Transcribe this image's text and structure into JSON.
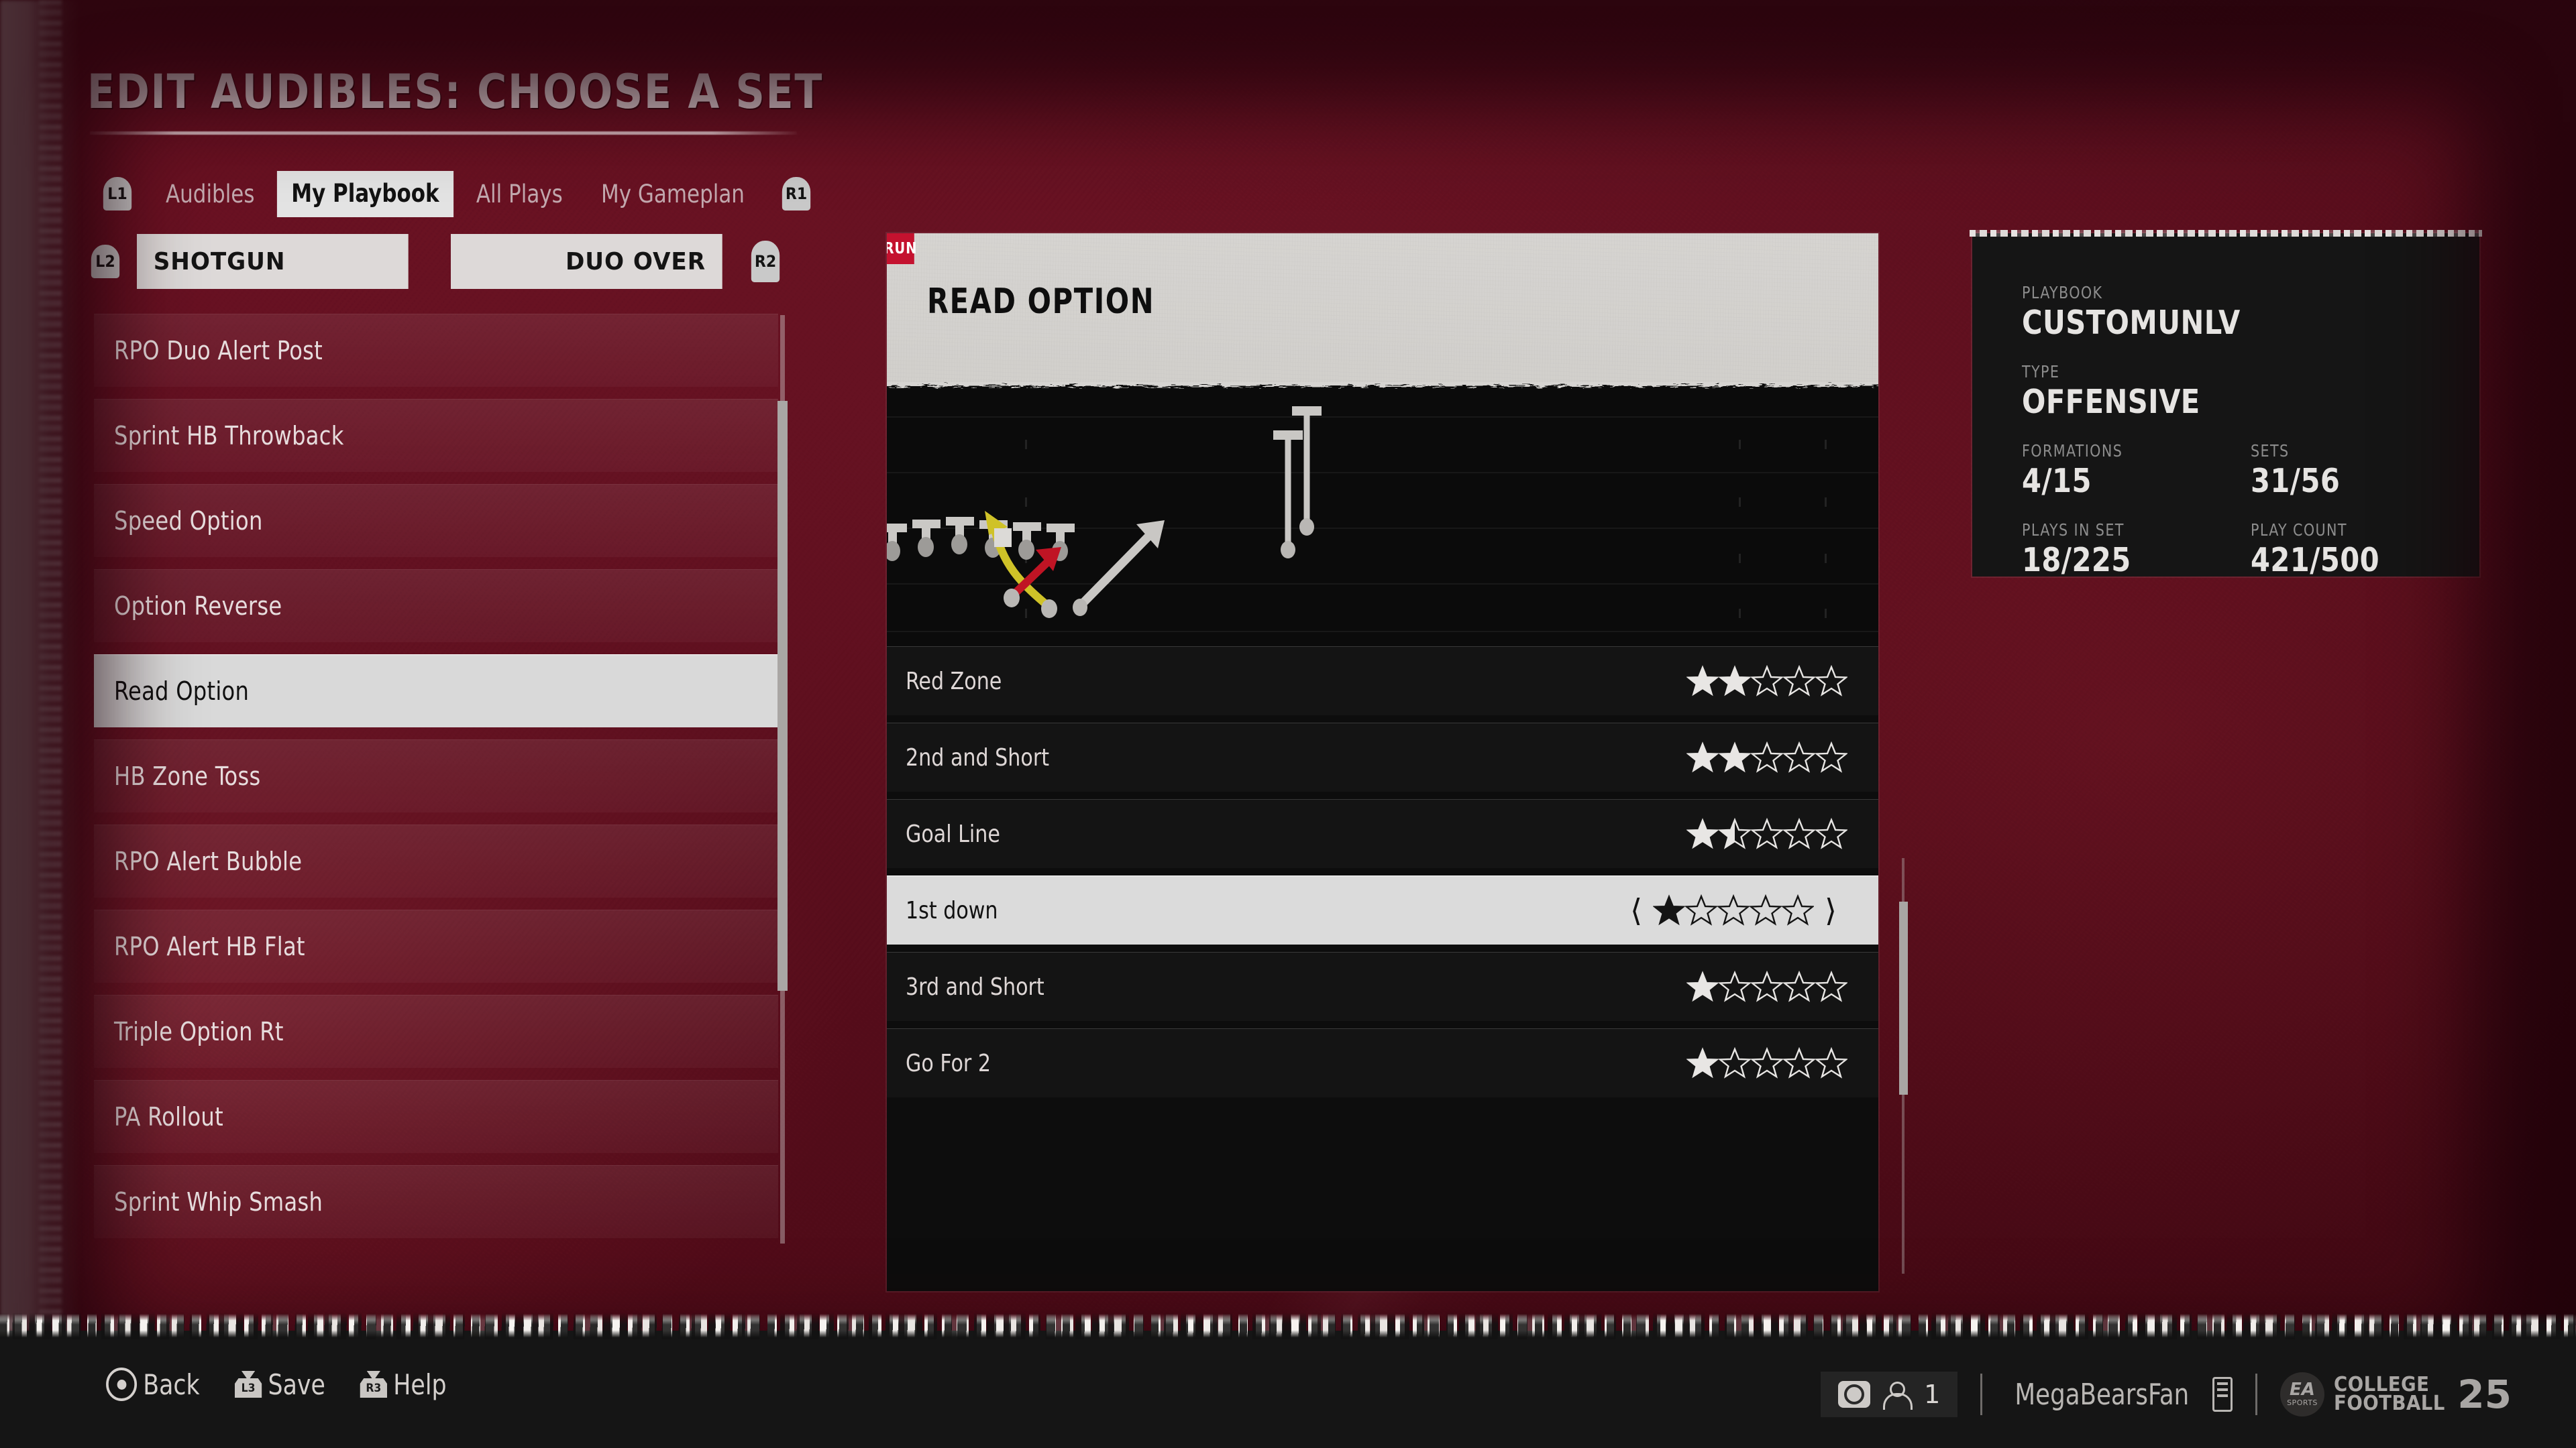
{
  "header": {
    "title": "EDIT AUDIBLES: CHOOSE A SET"
  },
  "tabs": {
    "left_bumper": "L1",
    "right_bumper": "R1",
    "items": [
      {
        "label": "Audibles",
        "selected": false
      },
      {
        "label": "My Playbook",
        "selected": true
      },
      {
        "label": "All Plays",
        "selected": false
      },
      {
        "label": "My Gameplan",
        "selected": false
      }
    ]
  },
  "set_selector": {
    "left_bumper": "L2",
    "right_bumper": "R2",
    "formation": "SHOTGUN",
    "set": "DUO OVER"
  },
  "playlist": {
    "items": [
      {
        "label": "RPO Duo Alert Post",
        "selected": false
      },
      {
        "label": "Sprint HB Throwback",
        "selected": false
      },
      {
        "label": "Speed Option",
        "selected": false
      },
      {
        "label": "Option Reverse",
        "selected": false
      },
      {
        "label": "Read Option",
        "selected": true
      },
      {
        "label": "HB Zone Toss",
        "selected": false
      },
      {
        "label": "RPO Alert Bubble",
        "selected": false
      },
      {
        "label": "RPO Alert HB Flat",
        "selected": false
      },
      {
        "label": "Triple Option Rt",
        "selected": false
      },
      {
        "label": "PA Rollout",
        "selected": false
      },
      {
        "label": "Sprint Whip Smash",
        "selected": false
      }
    ]
  },
  "play_card": {
    "type_tag": "RUN",
    "play_name": "READ OPTION",
    "type_tag_color": "#c4122f"
  },
  "situations": {
    "max_stars": 5,
    "prev_arrow": "‹",
    "next_arrow": "›",
    "rows": [
      {
        "label": "Red Zone",
        "stars": 2,
        "selected": false
      },
      {
        "label": "2nd and Short",
        "stars": 2,
        "selected": false
      },
      {
        "label": "Goal Line",
        "stars": 1.5,
        "selected": false
      },
      {
        "label": "1st down",
        "stars": 1,
        "selected": true
      },
      {
        "label": "3rd and Short",
        "stars": 1,
        "selected": false
      },
      {
        "label": "Go For 2",
        "stars": 1,
        "selected": false
      }
    ]
  },
  "info_panel": {
    "playbook_key": "PLAYBOOK",
    "playbook_value": "CUSTOMUNLV",
    "type_key": "TYPE",
    "type_value": "OFFENSIVE",
    "formations_key": "FORMATIONS",
    "formations_value": "4/15",
    "sets_key": "SETS",
    "sets_value": "31/56",
    "plays_in_set_key": "PLAYS IN SET",
    "plays_in_set_value": "18/225",
    "play_count_key": "PLAY COUNT",
    "play_count_value": "421/500"
  },
  "footer": {
    "hints": [
      {
        "icon": "circle-button-icon",
        "label": "Back",
        "stick": ""
      },
      {
        "icon": "left-stick-icon",
        "label": "Save",
        "stick": "L3"
      },
      {
        "icon": "right-stick-icon",
        "label": "Help",
        "stick": "R3"
      }
    ],
    "viewer_count": "1",
    "gamertag": "MegaBearsFan",
    "brand_ea": "EA",
    "brand_ea_sub": "SPORTS",
    "brand_line1": "COLLEGE",
    "brand_line2": "FOOTBALL",
    "brand_year": "25"
  },
  "theme": {
    "background": "#601020",
    "panel_dark": "#141414",
    "selected_light": "#d9d9d9",
    "accent_red": "#c4122f",
    "text_light": "#e2d2d6"
  }
}
